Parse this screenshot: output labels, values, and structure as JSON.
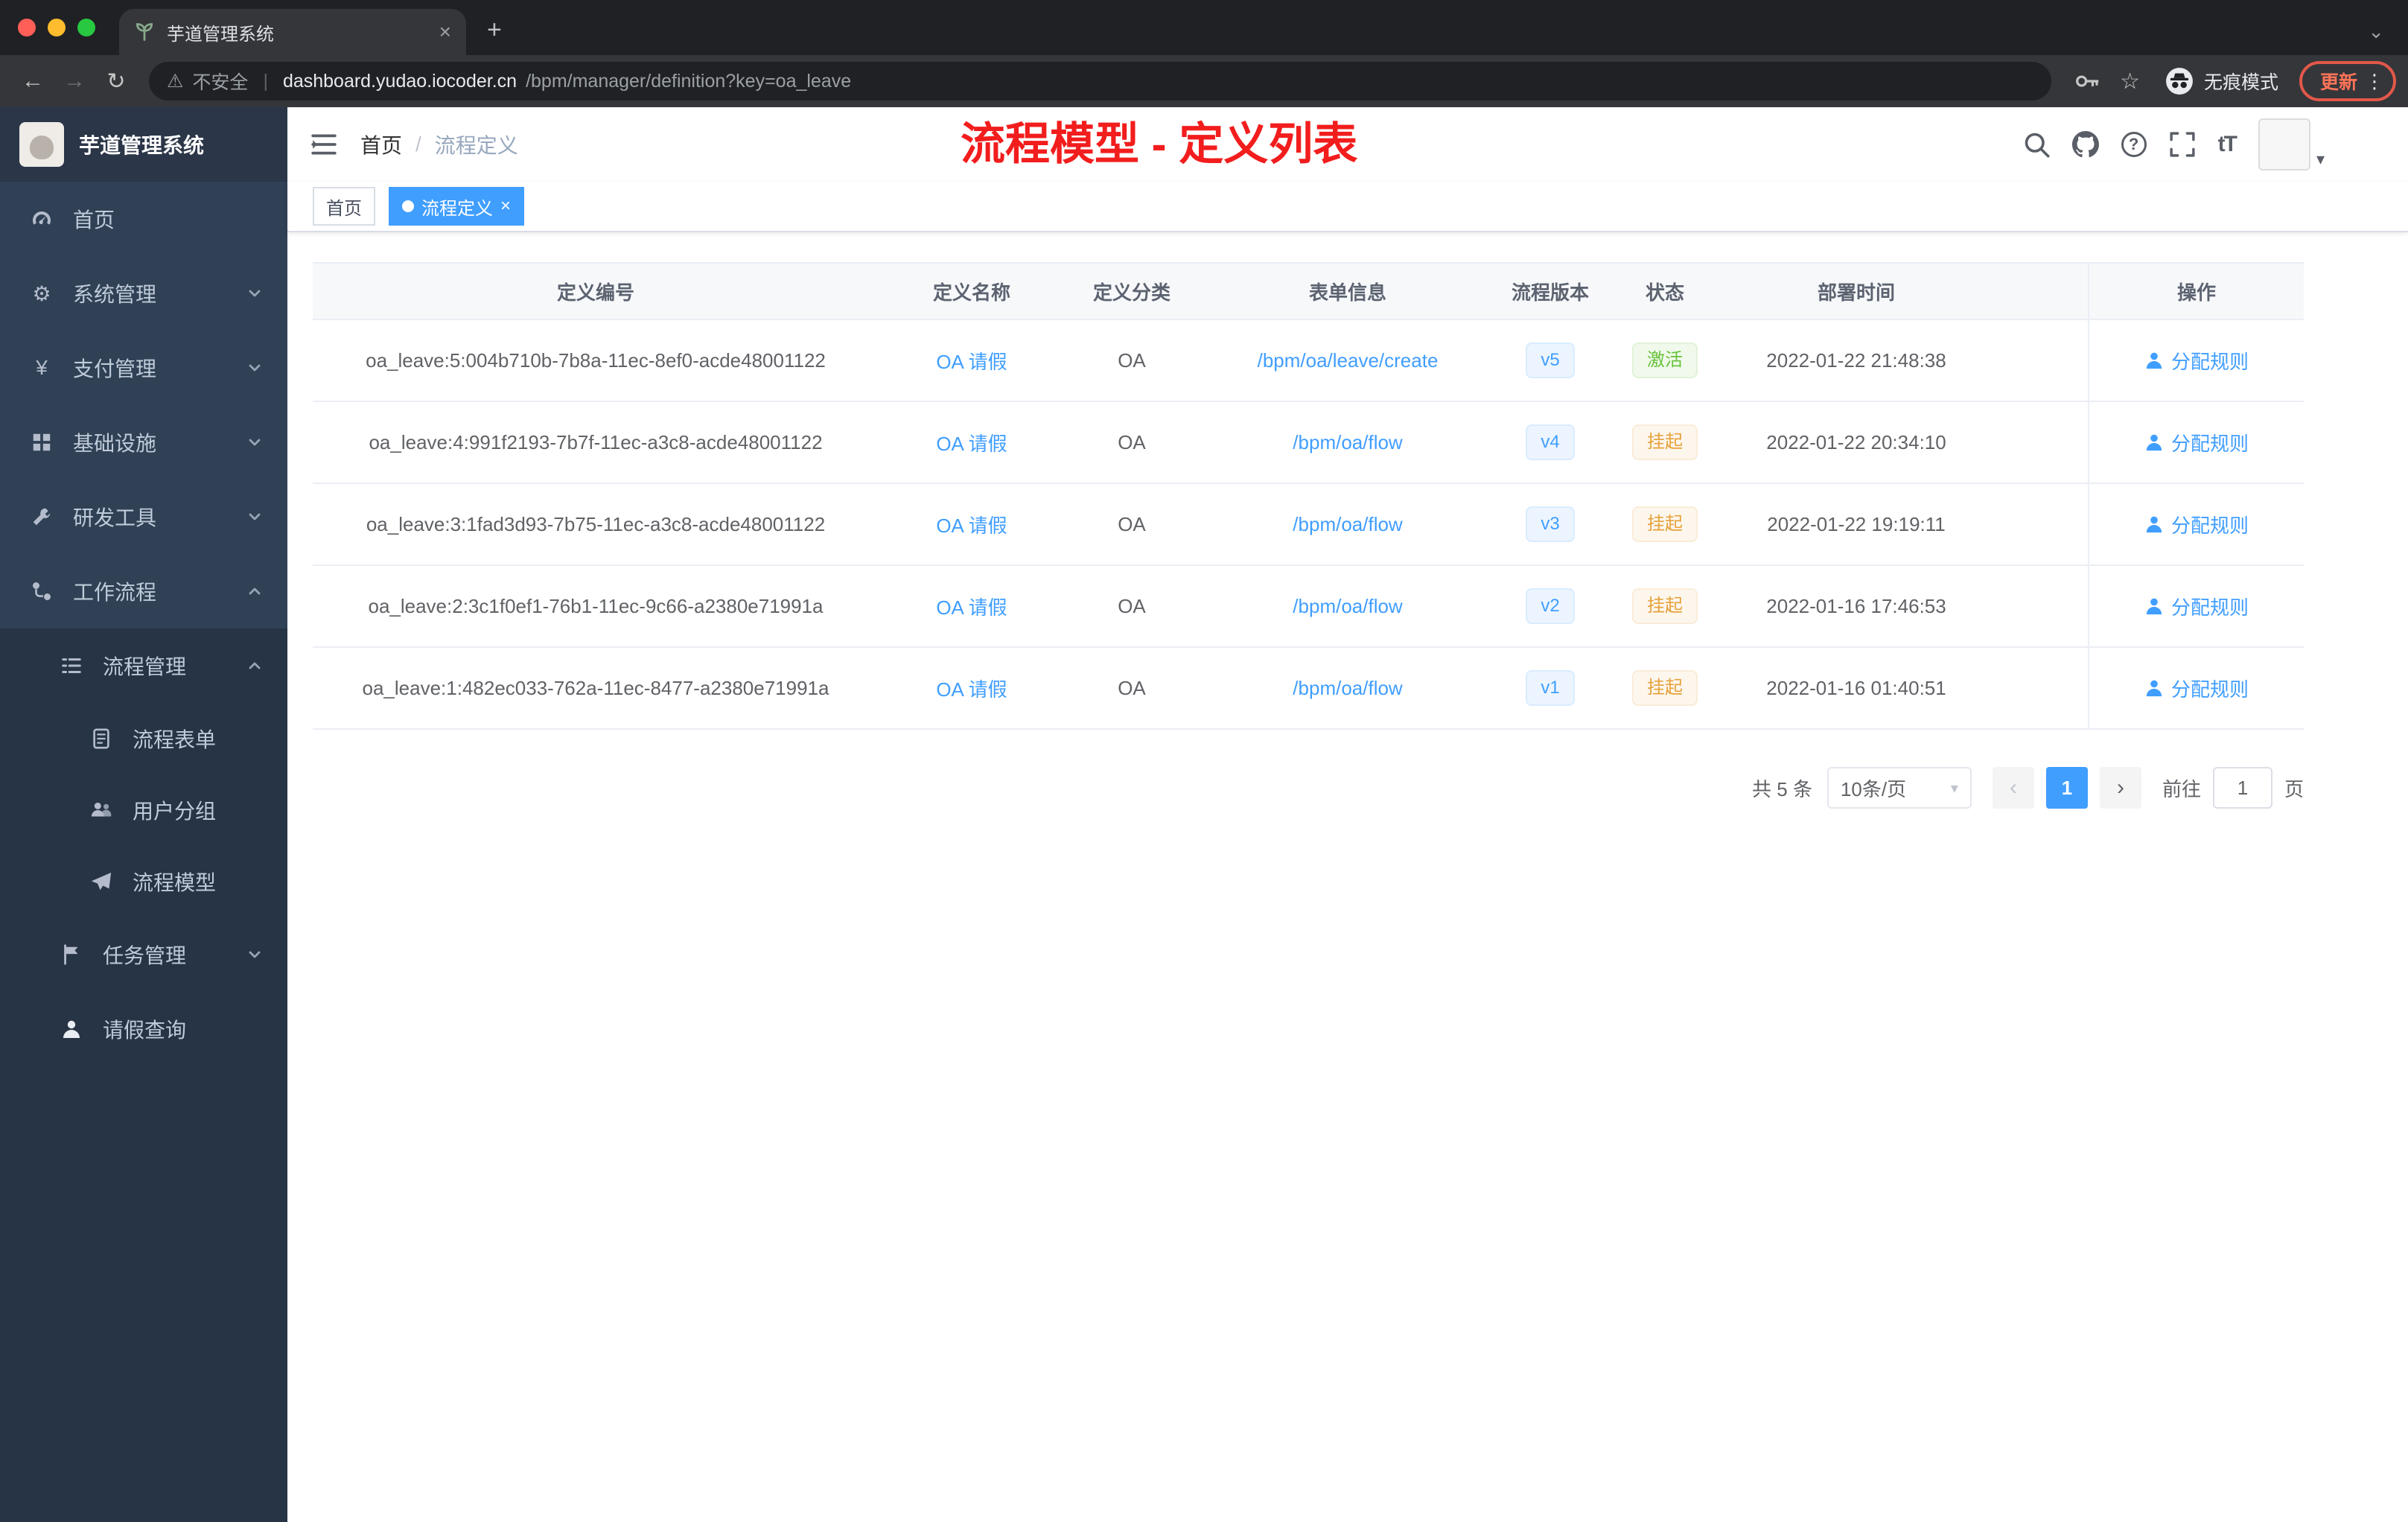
{
  "browser": {
    "tab_title": "芋道管理系统",
    "security_label": "不安全",
    "url_host": "dashboard.yudao.iocoder.cn",
    "url_path": "/bpm/manager/definition?key=oa_leave",
    "incognito_label": "无痕模式",
    "update_label": "更新"
  },
  "icons": {
    "back": "←",
    "forward": "→",
    "reload": "↻",
    "warning": "⚠",
    "star": "☆",
    "close_tab": "×",
    "new_tab": "+",
    "tab_search": "⌄",
    "menu_dots": "⋮",
    "gear": "⚙",
    "yen": "¥",
    "question": "?",
    "font_size": "tT",
    "caret_down": "▾",
    "prev": "‹",
    "next": "›",
    "tag_close": "×"
  },
  "sidebar": {
    "logo_title": "芋道管理系统",
    "items": [
      {
        "label": "首页"
      },
      {
        "label": "系统管理"
      },
      {
        "label": "支付管理"
      },
      {
        "label": "基础设施"
      },
      {
        "label": "研发工具"
      },
      {
        "label": "工作流程"
      }
    ],
    "process_group": {
      "label": "流程管理"
    },
    "process_children": [
      {
        "label": "流程表单"
      },
      {
        "label": "用户分组"
      },
      {
        "label": "流程模型"
      }
    ],
    "task_group": {
      "label": "任务管理"
    },
    "leave_query": {
      "label": "请假查询"
    }
  },
  "header": {
    "breadcrumb_home": "首页",
    "breadcrumb_sep": "/",
    "breadcrumb_current": "流程定义",
    "annotation": "流程模型 - 定义列表"
  },
  "tags": {
    "home": "首页",
    "active": "流程定义"
  },
  "table": {
    "headers": [
      "定义编号",
      "定义名称",
      "定义分类",
      "表单信息",
      "流程版本",
      "状态",
      "部署时间",
      "操作"
    ],
    "action_label": "分配规则",
    "rows": [
      {
        "id": "oa_leave:5:004b710b-7b8a-11ec-8ef0-acde48001122",
        "name": "OA 请假",
        "category": "OA",
        "form": "/bpm/oa/leave/create",
        "version": "v5",
        "status": "激活",
        "time": "2022-01-22 21:48:38"
      },
      {
        "id": "oa_leave:4:991f2193-7b7f-11ec-a3c8-acde48001122",
        "name": "OA 请假",
        "category": "OA",
        "form": "/bpm/oa/flow",
        "version": "v4",
        "status": "挂起",
        "time": "2022-01-22 20:34:10"
      },
      {
        "id": "oa_leave:3:1fad3d93-7b75-11ec-a3c8-acde48001122",
        "name": "OA 请假",
        "category": "OA",
        "form": "/bpm/oa/flow",
        "version": "v3",
        "status": "挂起",
        "time": "2022-01-22 19:19:11"
      },
      {
        "id": "oa_leave:2:3c1f0ef1-76b1-11ec-9c66-a2380e71991a",
        "name": "OA 请假",
        "category": "OA",
        "form": "/bpm/oa/flow",
        "version": "v2",
        "status": "挂起",
        "time": "2022-01-16 17:46:53"
      },
      {
        "id": "oa_leave:1:482ec033-762a-11ec-8477-a2380e71991a",
        "name": "OA 请假",
        "category": "OA",
        "form": "/bpm/oa/flow",
        "version": "v1",
        "status": "挂起",
        "time": "2022-01-16 01:40:51"
      }
    ]
  },
  "pagination": {
    "total": "共 5 条",
    "page_size": "10条/页",
    "current_page": "1",
    "goto_label": "前往",
    "goto_value": "1",
    "unit_label": "页"
  }
}
